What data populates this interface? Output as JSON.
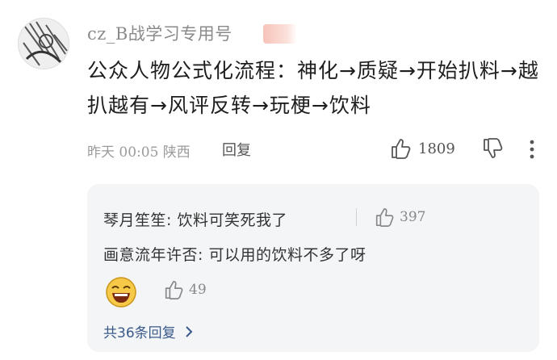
{
  "comment": {
    "username": "cz_B战学习专用号",
    "text": "公众人物公式化流程：神化→质疑→开始扒料→越扒越有→风评反转→玩梗→饮料",
    "time_location": "昨天 00:05 陕西",
    "reply_label": "回复",
    "like_count": "1809"
  },
  "replies": {
    "items": [
      {
        "text": "琴月笙笙: 饮料可笑死我了",
        "like_count": "397"
      },
      {
        "text": "画意流年许否: 可以用的饮料不多了呀"
      },
      {
        "like_count": "49"
      }
    ],
    "more_label": "共36条回复"
  },
  "colors": {
    "link": "#3a5a8a",
    "box_bg": "#f3f5f7",
    "meta": "#9a9a9a"
  },
  "icons": [
    "avatar",
    "thumb-up-icon",
    "thumb-down-icon",
    "more-vertical-icon",
    "laughing-emoji-icon",
    "chevron-right-icon"
  ]
}
